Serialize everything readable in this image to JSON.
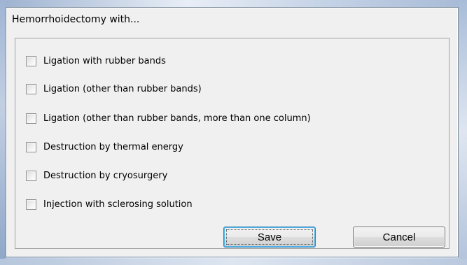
{
  "dialog": {
    "title": "Hemorrhoidectomy with..."
  },
  "options": [
    {
      "label": "Ligation with rubber bands",
      "checked": false
    },
    {
      "label": "Ligation (other than rubber bands)",
      "checked": false
    },
    {
      "label": "Ligation (other than rubber bands, more than one column)",
      "checked": false
    },
    {
      "label": "Destruction by thermal energy",
      "checked": false
    },
    {
      "label": "Destruction by cryosurgery",
      "checked": false
    },
    {
      "label": "Injection with sclerosing solution",
      "checked": false
    }
  ],
  "buttons": {
    "save_label": "Save",
    "cancel_label": "Cancel"
  },
  "colors": {
    "dialog_bg": "#f0f0f0",
    "default_button_border": "#3c7fb1"
  }
}
